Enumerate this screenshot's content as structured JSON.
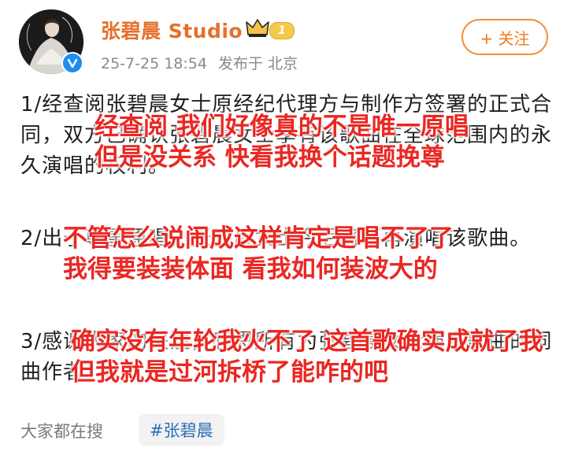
{
  "header": {
    "name": "张碧晨 Studio",
    "rank_badge": "1",
    "date": "25-7-25 18:54",
    "location": "发布于 北京",
    "follow_label": "+ 关注"
  },
  "post": {
    "paragraph_1": "1/经查阅张碧晨女士原经纪代理方与制作方签署的正式合同，双方已确认张碧晨女士享有该歌曲在全球范围内的永久演唱的权利。",
    "paragraph_2": "2/出于尊重原唱，张碧晨女士今后将不再演唱该歌曲。",
    "paragraph_3": "3/感谢大家的关注，感恩所有为张碧晨女士演唱歌曲的词曲作者。"
  },
  "overlays": {
    "block_1": [
      "经查阅 我们好像真的不是唯一原唱",
      "但是没关系 快看我换个话题挽尊"
    ],
    "block_2": [
      "不管怎么说闹成这样肯定是唱不了了",
      "我得要装装体面 看我如何装波大的"
    ],
    "block_3": [
      "确实没有年轮我火不了 这首歌确实成就了我",
      "但我就是过河拆桥了能咋的吧"
    ]
  },
  "footer": {
    "search_label": "大家都在搜",
    "hashtag": "#张碧晨"
  },
  "colors": {
    "name": "#e5702a",
    "overlay_text": "#ea2722",
    "hashtag": "#2d6fb8",
    "follow_border": "#f29038"
  }
}
